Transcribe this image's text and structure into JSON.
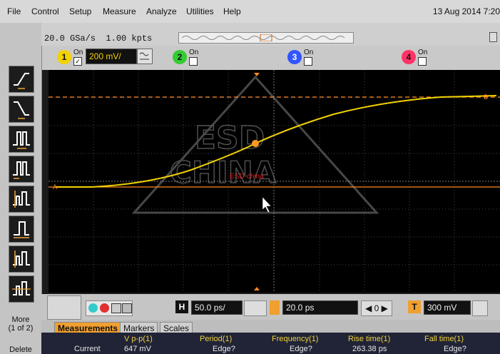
{
  "menu": {
    "items": [
      "File",
      "Control",
      "Setup",
      "Measure",
      "Analyze",
      "Utilities",
      "Help"
    ],
    "date": "13 Aug 2014  7:20"
  },
  "acquisition": {
    "sample_rate": "20.0 GSa/s",
    "points": "1.00 kpts"
  },
  "channels": [
    {
      "number": "1",
      "on_label": "On",
      "checked": true,
      "scale": "200 mV/",
      "color": "#f2d200"
    },
    {
      "number": "2",
      "on_label": "On",
      "checked": false,
      "color": "#33cc33"
    },
    {
      "number": "3",
      "on_label": "On",
      "checked": false,
      "color": "#3355ff"
    },
    {
      "number": "4",
      "on_label": "On",
      "checked": false,
      "color": "#ff3366"
    }
  ],
  "sidebar": {
    "more_label": "More",
    "more_page": "(1 of 2)",
    "delete_label": "Delete"
  },
  "graticule": {
    "watermark_text": "ESD-china",
    "trace_color": "#f2d200",
    "marker_color": "#ff8a20"
  },
  "horizontal": {
    "label": "H",
    "time_scale": "50.0 ps/",
    "position": "20.0 ps",
    "run_value": "0"
  },
  "trigger": {
    "label": "T",
    "level": "300 mV"
  },
  "tabs": {
    "measurements": "Measurements",
    "markers": "Markers",
    "scales": "Scales"
  },
  "measurements": {
    "row_label": "Current",
    "columns": [
      {
        "header": "V p-p(1)",
        "value": "647 mV"
      },
      {
        "header": "Period(1)",
        "value": "Edge?"
      },
      {
        "header": "Frequency(1)",
        "value": "Edge?"
      },
      {
        "header": "Rise time(1)",
        "value": "263.38 ps"
      },
      {
        "header": "Fall time(1)",
        "value": "Edge?"
      }
    ]
  },
  "colors": {
    "accent_tab": "#f0a030",
    "readout_bg": "#202436"
  }
}
